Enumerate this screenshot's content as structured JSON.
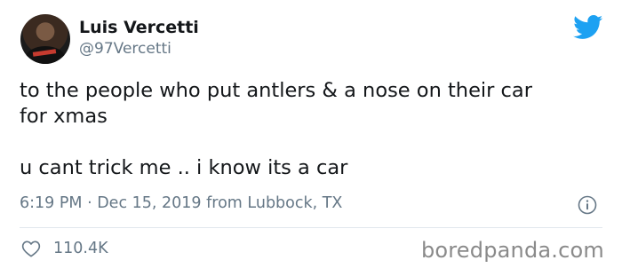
{
  "author": {
    "display_name": "Luis Vercetti",
    "handle": "@97Vercetti"
  },
  "tweet": {
    "text": "to the people who put antlers & a nose on their car\nfor xmas\n\nu cant trick me .. i know its a car",
    "meta": "6:19 PM · Dec 15, 2019 from Lubbock, TX",
    "likes": "110.4K"
  },
  "icons": {
    "brand": "twitter-bird-icon",
    "info": "info-icon",
    "like": "heart-icon"
  },
  "colors": {
    "twitter_blue": "#1da1f2",
    "secondary_text": "#657786"
  },
  "watermark": "boredpanda.com"
}
